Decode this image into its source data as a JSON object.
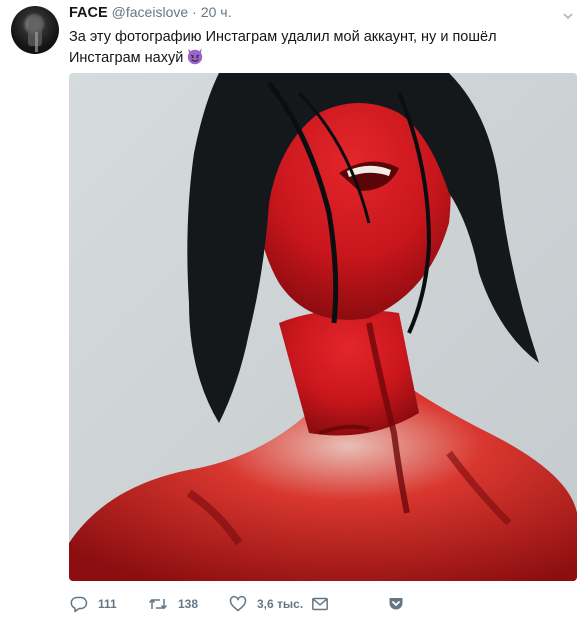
{
  "tweet": {
    "author_name": "FACE",
    "author_handle": "@faceislove",
    "separator": "·",
    "time": "20 ч.",
    "text": "За эту фотографию Инстаграм удалил мой аккаунт, ну и пошёл Инстаграм нахуй",
    "emoji_icon": "smiling-imp-emoji",
    "media_alt": "",
    "colors": {
      "text": "#14171a",
      "secondary": "#657786",
      "emoji_purple": "#8b59b6",
      "blood_red": "#c8161c",
      "background_grey": "#cfd4d6"
    }
  },
  "actions": {
    "reply_count": "111",
    "retweet_count": "138",
    "like_count": "3,6 тыс.",
    "reply_icon": "reply-icon",
    "retweet_icon": "retweet-icon",
    "like_icon": "heart-icon",
    "dm_icon": "envelope-icon",
    "save_icon": "pocket-save-icon"
  }
}
